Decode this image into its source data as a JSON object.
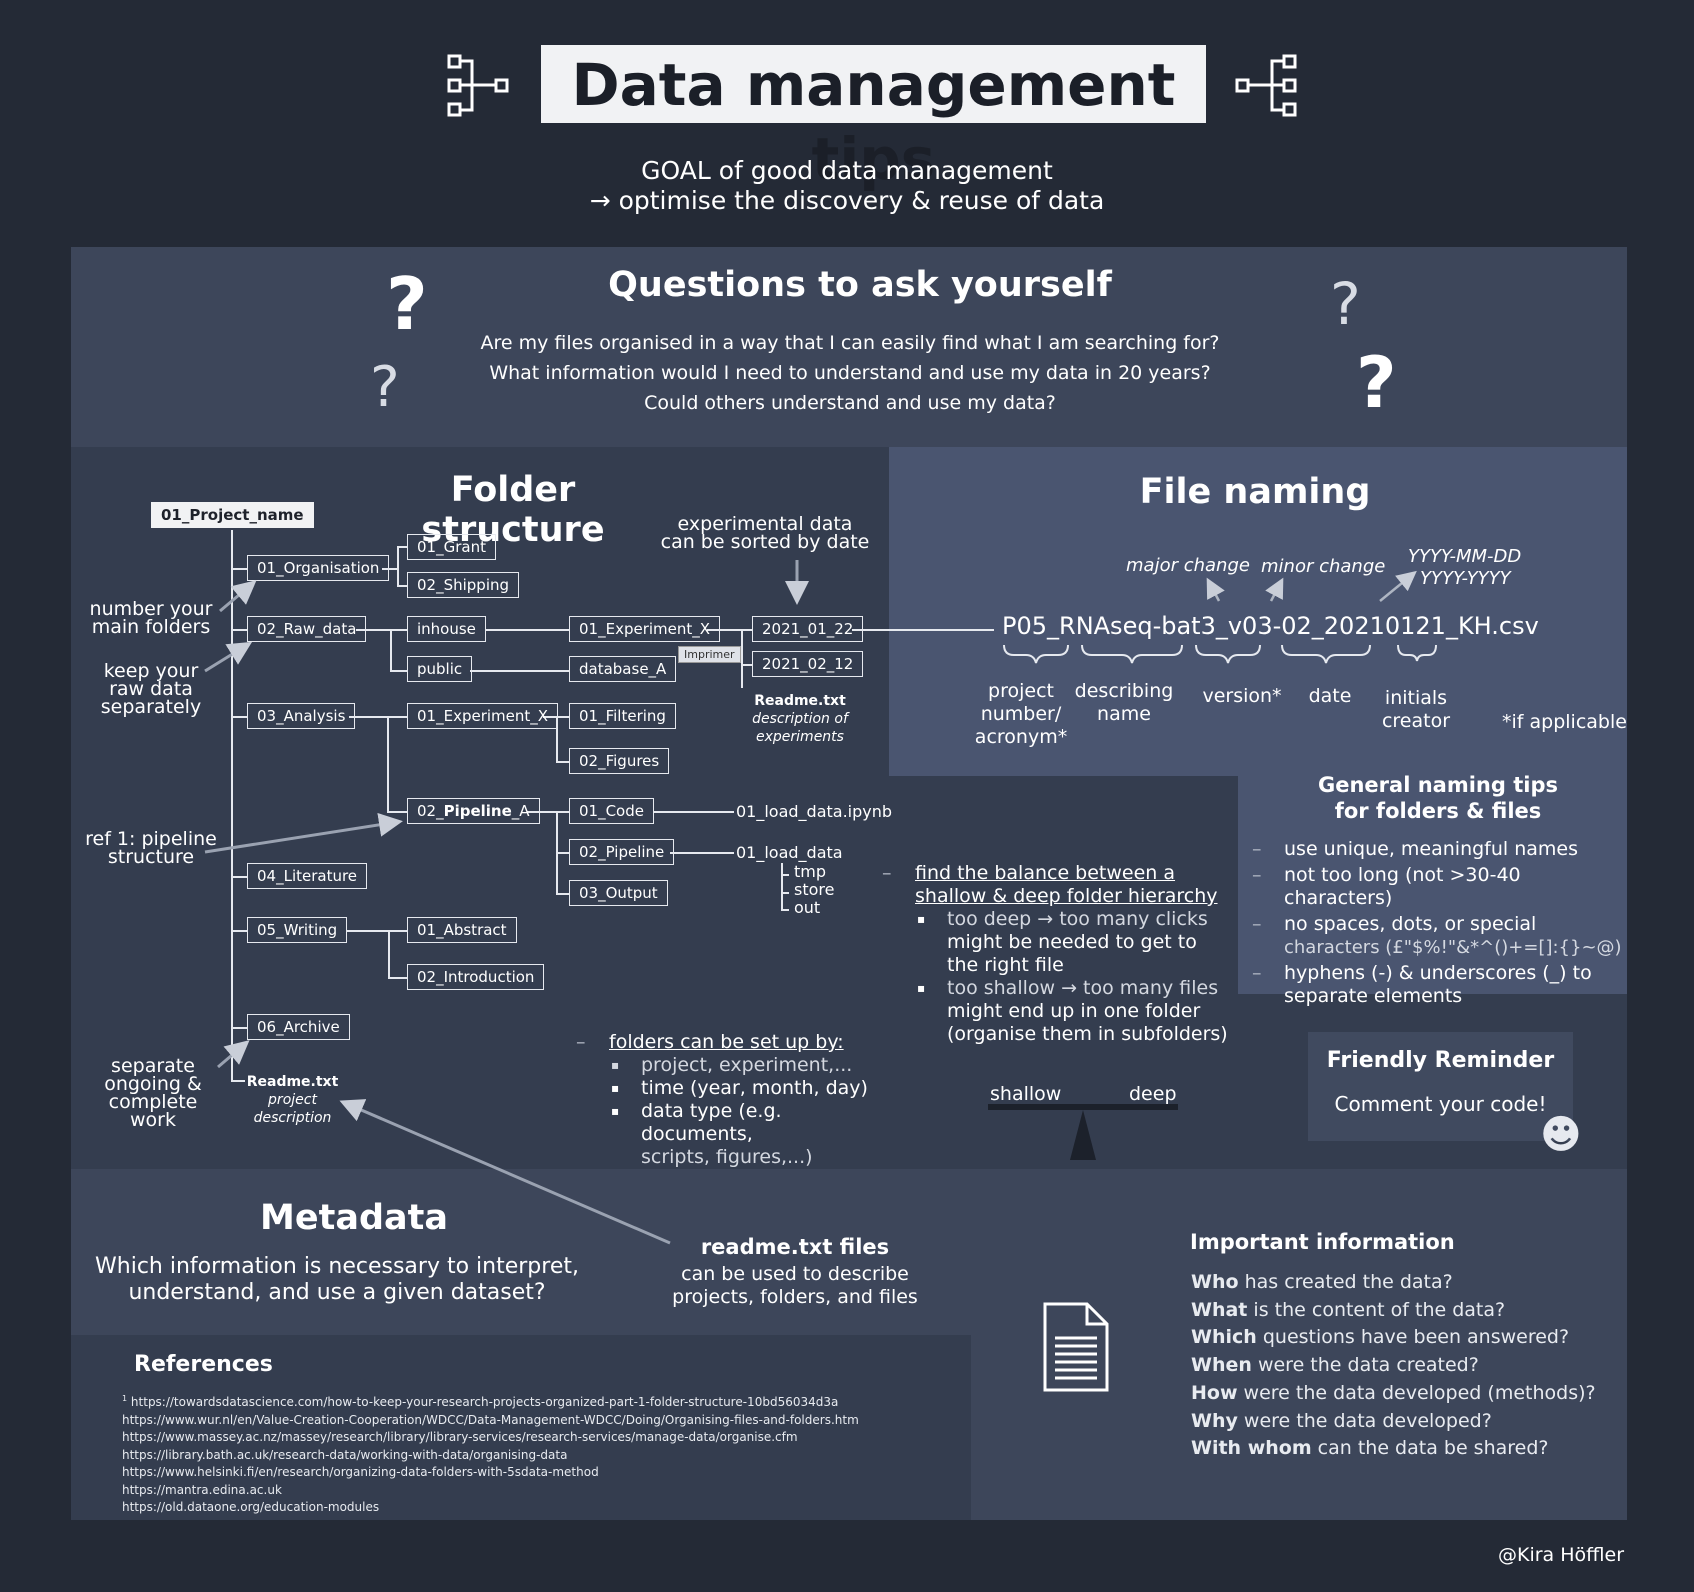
{
  "header": {
    "title": "Data management tips",
    "goal_line1": "GOAL of good data management",
    "goal_line2": "→ optimise the discovery & reuse of data"
  },
  "questions": {
    "title": "Questions to ask yourself",
    "q1": "Are my files organised in a way that I can easily find  what I am searching for?",
    "q2": "What information would I need to understand and use my data in 20 years?",
    "q3": "Could others understand and use my data?",
    "qmark": "?"
  },
  "folder_structure": {
    "title": "Folder structure",
    "root": "01_Project_name",
    "n_organisation": "01_Organisation",
    "n_grant": "01_Grant",
    "n_shipping": "02_Shipping",
    "n_raw": "02_Raw_data",
    "n_inhouse": "inhouse",
    "n_public": "public",
    "n_exp_x": "01_Experiment_X",
    "n_database": "database_A",
    "n_date1": "2021_01_22",
    "n_date2": "2021_02_12",
    "n_imprimer": "Imprimer",
    "readme_exp": "Readme.txt",
    "readme_exp_desc1": "description of",
    "readme_exp_desc2": "experiments",
    "n_analysis": "03_Analysis",
    "n_exp_x2": "01_Experiment_X",
    "n_filtering": "01_Filtering",
    "n_figures": "02_Figures",
    "n_pipeline_a_pre": "02_",
    "n_pipeline_a_bold": "Pipeline",
    "n_pipeline_a_post": "_A",
    "n_code": "01_Code",
    "n_pipeline": "02_Pipeline",
    "n_output": "03_Output",
    "f_ipynb": "01_load_data.ipynb",
    "f_load": "01_load_data",
    "f_tmp": "tmp",
    "f_store": "store",
    "f_out": "out",
    "n_literature": "04_Literature",
    "n_writing": "05_Writing",
    "n_abstract": "01_Abstract",
    "n_intro": "02_Introduction",
    "n_archive": "06_Archive",
    "readme_proj": "Readme.txt",
    "readme_proj_desc1": "project",
    "readme_proj_desc2": "description",
    "note_number_1": "number your",
    "note_number_2": "main folders",
    "note_raw_1": "keep your",
    "note_raw_2": "raw data",
    "note_raw_3": "separately",
    "note_ref_1": "ref 1: pipeline",
    "note_ref_2": "structure",
    "note_sep_1": "separate",
    "note_sep_2": "ongoing &",
    "note_sep_3": "complete",
    "note_sep_4": "work",
    "note_exp_1": "experimental data",
    "note_exp_2": "can be sorted by date",
    "balance_title_1": "find the balance between a",
    "balance_title_2": "shallow & deep folder hierarchy",
    "balance_b1_1": "too deep → too many clicks",
    "balance_b1_2": "might be needed to get to",
    "balance_b1_3": "the right file",
    "balance_b2_1": "too shallow → too many files",
    "balance_b2_2": "might end up in one folder",
    "balance_b2_3": "(organise them in subfolders)",
    "setup_title": "folders can be set up by:",
    "setup_1": "project, experiment,...",
    "setup_2": "time (year, month, day)",
    "setup_3_1": "data type (e.g. documents,",
    "setup_3_2": "scripts, figures,...)",
    "scale_left": "shallow",
    "scale_right": "deep"
  },
  "file_naming": {
    "title": "File naming",
    "major": "major change",
    "minor": "minor change",
    "date_fmt1": "YYYY-MM-DD",
    "date_fmt2": "YYYY-YYYY",
    "filename": "P05_RNAseq-bat3_v03-02_20210121_KH.csv",
    "part_project_1": "project",
    "part_project_2": "number/",
    "part_project_3": "acronym*",
    "part_desc_1": "describing",
    "part_desc_2": "name",
    "part_version": "version*",
    "part_date": "date",
    "part_init_1": "initials",
    "part_init_2": "creator",
    "if_applicable": "*if applicable"
  },
  "naming_tips": {
    "title_1": "General naming tips",
    "title_2": "for folders & files",
    "t1": "use unique, meaningful names",
    "t2": "not too long (not >30-40 characters)",
    "t3_1": "no spaces, dots, or special",
    "t3_2": "characters (£\"$%!\"&*^()+=[]:{}~@)",
    "t4_1": "hyphens (-) & underscores (_) to",
    "t4_2": "separate elements"
  },
  "reminder": {
    "title": "Friendly Reminder",
    "text": "Comment your code!",
    "smiley": "☻"
  },
  "metadata": {
    "title": "Metadata",
    "q_1": "Which information is necessary to interpret,",
    "q_2": "understand, and use a given dataset?",
    "readme_title": "readme.txt files",
    "readme_1": "can be used to describe",
    "readme_2": "projects, folders, and files"
  },
  "important": {
    "title": "Important information",
    "items": [
      {
        "bold": "Who",
        "rest": " has created the data?"
      },
      {
        "bold": "What",
        "rest": " is the content of the data?"
      },
      {
        "bold": "Which",
        "rest": " questions have been answered?"
      },
      {
        "bold": "When",
        "rest": " were the data created?"
      },
      {
        "bold": "How",
        "rest": " were the data developed (methods)?"
      },
      {
        "bold": "Why",
        "rest": " were the data developed?"
      },
      {
        "bold": "With whom",
        "rest": " can the data be shared?"
      }
    ]
  },
  "references": {
    "title": "References",
    "sup": "1",
    "r1": "https://towardsdatascience.com/how-to-keep-your-research-projects-organized-part-1-folder-structure-10bd56034d3a",
    "r2": "https://www.wur.nl/en/Value-Creation-Cooperation/WDCC/Data-Management-WDCC/Doing/Organising-files-and-folders.htm",
    "r3": "https://www.massey.ac.nz/massey/research/library/library-services/research-services/manage-data/organise.cfm",
    "r4": "https://library.bath.ac.uk/research-data/working-with-data/organising-data",
    "r5": "https://www.helsinki.fi/en/research/organizing-data-folders-with-5sdata-method",
    "r6": "https://mantra.edina.ac.uk",
    "r7": "https://old.dataone.org/education-modules"
  },
  "credit": "@Kira Höffler",
  "colors": {
    "background": "#242a36",
    "panel_dark": "#343d4f",
    "panel_light": "#4a5570",
    "panel_mid": "#3d465a",
    "text": "#ffffff"
  },
  "icons": [
    "tree-diagram-icon",
    "question-mark-icon",
    "document-icon",
    "smiley-icon",
    "scale-icon"
  ]
}
